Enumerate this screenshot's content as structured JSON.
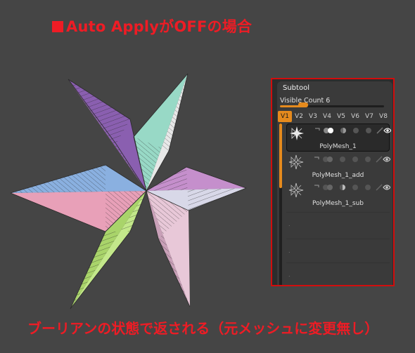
{
  "caption_top": "Auto ApplyがOFFの場合",
  "caption_bottom": "ブーリアンの状態で返される（元メッシュに変更無し）",
  "subtool": {
    "title": "Subtool",
    "visible_count_label": "Visible Count",
    "visible_count_value": "6",
    "visible_count_fraction": 0.2,
    "version_tabs": [
      "V1",
      "V2",
      "V3",
      "V4",
      "V5",
      "V6",
      "V7",
      "V8"
    ],
    "active_tab": "V1",
    "items": [
      {
        "name": "PolyMesh_1",
        "selected": true
      },
      {
        "name": "PolyMesh_1_add",
        "selected": false
      },
      {
        "name": "PolyMesh_1_sub",
        "selected": false
      }
    ],
    "empty_slots": [
      ".",
      ".",
      "."
    ]
  },
  "colors": {
    "caption_red": "#ee1c25",
    "accent_orange": "#e58a1d",
    "frame_red": "#d20d0d",
    "background": "#454545"
  }
}
